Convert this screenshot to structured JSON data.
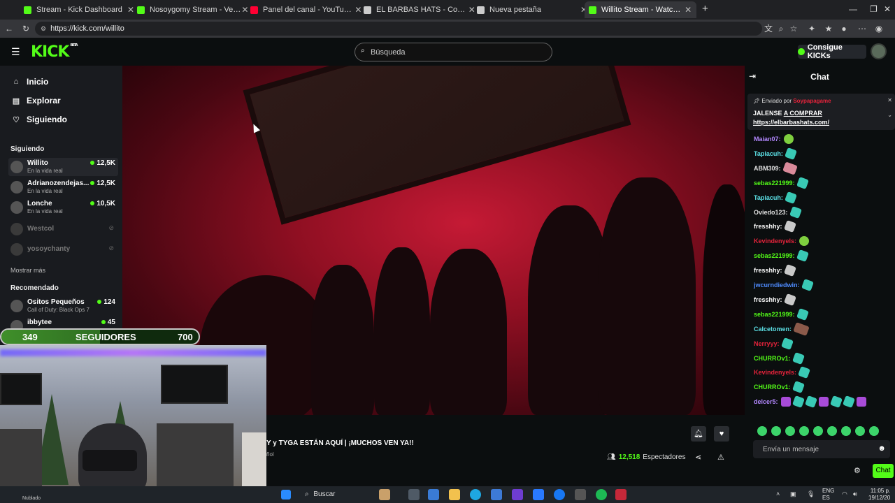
{
  "browser": {
    "tabs": [
      {
        "title": "Stream - Kick Dashboard",
        "color": "#53fc18"
      },
      {
        "title": "Nosoygomy Stream - Ver en direc",
        "color": "#53fc18"
      },
      {
        "title": "Panel del canal - YouTube Studio",
        "color": "#ff0033"
      },
      {
        "title": "EL BARBAS HATS - Compañía de s",
        "color": "#cccccc"
      },
      {
        "title": "Nueva pestaña",
        "color": "#cccccc"
      },
      {
        "title": "Willito Stream - Watch Live o",
        "color": "#53fc18"
      }
    ],
    "url": "https://kick.com/willito"
  },
  "header": {
    "logo": "KICK",
    "logo_badge": "BETA",
    "search_placeholder": "Búsqueda",
    "kicks_button": "Consigue KICKs"
  },
  "sidebar": {
    "nav": [
      {
        "label": "Inicio",
        "icon": "home-icon"
      },
      {
        "label": "Explorar",
        "icon": "compass-icon"
      },
      {
        "label": "Siguiendo",
        "icon": "heart-icon"
      }
    ],
    "following_title": "Siguiendo",
    "following": [
      {
        "name": "Willito",
        "category": "En la vida real",
        "viewers": "12,5K",
        "live": true
      },
      {
        "name": "Adrianozendejas...",
        "category": "En la vida real",
        "viewers": "12,5K",
        "live": true
      },
      {
        "name": "Lonche",
        "category": "En la vida real",
        "viewers": "10,5K",
        "live": true
      },
      {
        "name": "Westcol",
        "live": false
      },
      {
        "name": "yosoychanty",
        "live": false
      }
    ],
    "show_more": "Mostrar más",
    "recommended_title": "Recomendado",
    "recommended": [
      {
        "name": "Ositos Pequeños",
        "category": "Call of Duty: Black Ops 7",
        "viewers": "124"
      },
      {
        "name": "ibbytee",
        "viewers": "45"
      }
    ]
  },
  "overlay": {
    "followers_current": "349",
    "followers_label": "SEGUIDORES",
    "followers_goal": "700",
    "followers_progress": 0.4986
  },
  "stream": {
    "title_fragment": "Y y TYGA ESTÁN AQUÍ | ¡MUCHOS VEN YA!!",
    "language_fragment": "ñol",
    "viewer_count": "12,518",
    "viewers_label": "Espectadores"
  },
  "chat": {
    "title": "Chat",
    "pinned_by_label": "Enviado por",
    "pinned_by_user": "Soypapagame",
    "pinned_message_line1": "JALENSE ",
    "pinned_message_link": "A COMPRAR",
    "pinned_url": "https://elbarbashats.com/",
    "messages": [
      {
        "user": "Maian07:",
        "color": "#b388ff",
        "emote": "face"
      },
      {
        "user": "Tapiacuh:",
        "color": "#5ce1e6",
        "emote": "teal"
      },
      {
        "user": "ABM309:",
        "color": "#e0e0e0",
        "emote": "pink"
      },
      {
        "user": "sebas221999:",
        "color": "#53fc18",
        "emote": "teal"
      },
      {
        "user": "Tapiacuh:",
        "color": "#5ce1e6",
        "emote": "teal"
      },
      {
        "user": "Oviedo123:",
        "color": "#e0e0e0",
        "emote": "teal"
      },
      {
        "user": "fresshhy:",
        "color": "#ffffff",
        "emote": "gray"
      },
      {
        "user": "Kevindenyels:",
        "color": "#e5233b",
        "emote": "face"
      },
      {
        "user": "sebas221999:",
        "color": "#53fc18",
        "emote": "teal"
      },
      {
        "user": "fresshhy:",
        "color": "#ffffff",
        "emote": "gray"
      },
      {
        "user": "jwcurndiedwin:",
        "color": "#4f8cff",
        "emote": "teal"
      },
      {
        "user": "fresshhy:",
        "color": "#ffffff",
        "emote": "gray"
      },
      {
        "user": "sebas221999:",
        "color": "#53fc18",
        "emote": "teal"
      },
      {
        "user": "Calcetomen:",
        "color": "#5ce1e6",
        "emote": "brown"
      },
      {
        "user": "Nerryyy:",
        "color": "#e5233b",
        "emote": "teal"
      },
      {
        "user": "CHURROv1:",
        "color": "#53fc18",
        "emote": "teal"
      },
      {
        "user": "Kevindenyels:",
        "color": "#e5233b",
        "emote": "teal"
      },
      {
        "user": "CHURROv1:",
        "color": "#53fc18",
        "emote": "teal"
      },
      {
        "user": "delcer5:",
        "color": "#b388ff",
        "emote": "purple"
      }
    ],
    "input_placeholder": "Envía un mensaje",
    "send_label": "Chat"
  },
  "taskbar": {
    "search_label": "Buscar",
    "weather": "Nublado",
    "lang_top": "ENG",
    "lang_bottom": "ES",
    "time": "11:05 p.",
    "date": "19/12/20"
  }
}
